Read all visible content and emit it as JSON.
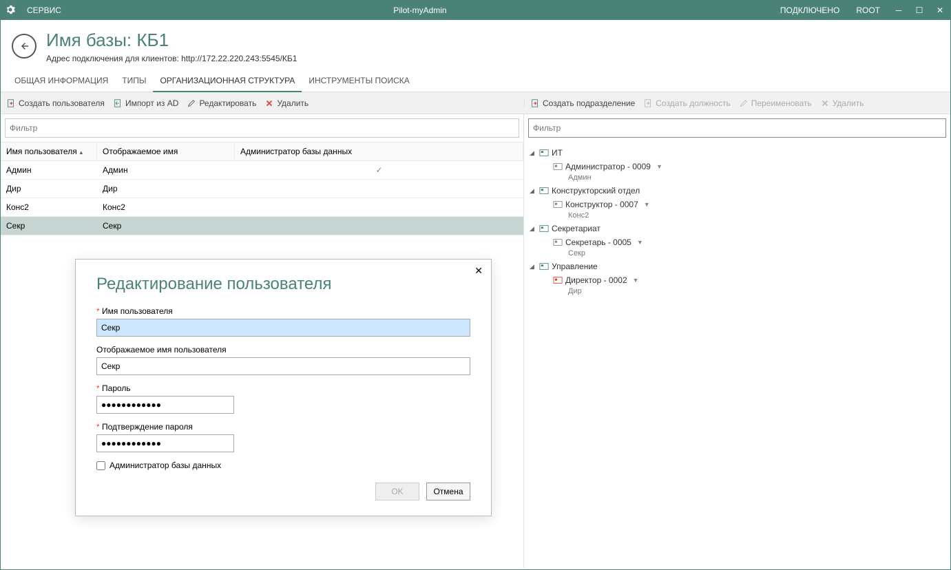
{
  "titlebar": {
    "service": "СЕРВИС",
    "app": "Pilot-myAdmin",
    "status": "ПОДКЛЮЧЕНО",
    "user": "ROOT"
  },
  "header": {
    "title": "Имя базы: КБ1",
    "subtitle": "Адрес подключения для клиентов: http://172.22.220.243:5545/КБ1"
  },
  "tabs": {
    "t1": "ОБЩАЯ ИНФОРМАЦИЯ",
    "t2": "ТИПЫ",
    "t3": "ОРГАНИЗАЦИОННАЯ СТРУКТУРА",
    "t4": "ИНСТРУМЕНТЫ ПОИСКА"
  },
  "toolbar": {
    "create_user": "Создать пользователя",
    "import_ad": "Импорт из AD",
    "edit": "Редактировать",
    "delete": "Удалить",
    "create_dept": "Создать подразделение",
    "create_pos": "Создать должность",
    "rename": "Переименовать",
    "delete2": "Удалить"
  },
  "filter": {
    "left": "Фильтр",
    "right": "Фильтр"
  },
  "grid": {
    "h1": "Имя пользователя",
    "h2": "Отображаемое имя",
    "h3": "Администратор базы данных",
    "rows": [
      {
        "u": "Админ",
        "d": "Админ",
        "a": "✓"
      },
      {
        "u": "Дир",
        "d": "Дир",
        "a": ""
      },
      {
        "u": "Конс2",
        "d": "Конс2",
        "a": ""
      },
      {
        "u": "Секр",
        "d": "Секр",
        "a": ""
      }
    ]
  },
  "tree": {
    "n1": "ИТ",
    "n1a": "Администратор - 0009",
    "n1a_sub": "Админ",
    "n2": "Конструкторский отдел",
    "n2a": "Конструктор - 0007",
    "n2a_sub": "Конс2",
    "n3": "Секретариат",
    "n3a": "Секретарь - 0005",
    "n3a_sub": "Секр",
    "n4": "Управление",
    "n4a": "Директор - 0002",
    "n4a_sub": "Дир"
  },
  "dialog": {
    "title": "Редактирование пользователя",
    "username_label": "Имя пользователя",
    "username_value": "Секр",
    "display_label": "Отображаемое имя пользователя",
    "display_value": "Секр",
    "password_label": "Пароль",
    "password_value": "●●●●●●●●●●●●",
    "confirm_label": "Подтверждение пароля",
    "confirm_value": "●●●●●●●●●●●●",
    "admin_label": "Администратор базы данных",
    "ok": "OK",
    "cancel": "Отмена"
  }
}
